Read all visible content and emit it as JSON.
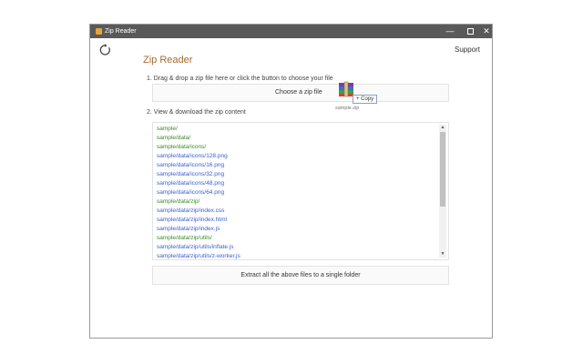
{
  "window": {
    "title": "Zip Reader",
    "minimize_glyph": "—",
    "close_glyph": "✕"
  },
  "header": {
    "support_label": "Support",
    "app_title": "Zip Reader"
  },
  "step1": {
    "text": "1. Drag & drop a zip file here or click the button to choose your file",
    "button_label": "Choose a zip file",
    "dragged_file_name": "sample.zip",
    "copy_tooltip": "+ Copy"
  },
  "step2": {
    "text": "2. View & download the zip content",
    "entries": [
      {
        "path": "sample/",
        "kind": "folder"
      },
      {
        "path": "sample/data/",
        "kind": "folder"
      },
      {
        "path": "sample/data/icons/",
        "kind": "folder"
      },
      {
        "path": "sample/data/icons/128.png",
        "kind": "file"
      },
      {
        "path": "sample/data/icons/16.png",
        "kind": "file"
      },
      {
        "path": "sample/data/icons/32.png",
        "kind": "file"
      },
      {
        "path": "sample/data/icons/48.png",
        "kind": "file"
      },
      {
        "path": "sample/data/icons/64.png",
        "kind": "file"
      },
      {
        "path": "sample/data/zip/",
        "kind": "folder"
      },
      {
        "path": "sample/data/zip/index.css",
        "kind": "file"
      },
      {
        "path": "sample/data/zip/index.html",
        "kind": "file"
      },
      {
        "path": "sample/data/zip/index.js",
        "kind": "file"
      },
      {
        "path": "sample/data/zip/utils/",
        "kind": "folder"
      },
      {
        "path": "sample/data/zip/utils/inflate.js",
        "kind": "file"
      },
      {
        "path": "sample/data/zip/utils/z-worker.js",
        "kind": "file"
      }
    ],
    "extract_label": "Extract all the above files to a single folder"
  },
  "colors": {
    "accent_title": "#a8692e",
    "folder_link": "#3a8a2c",
    "file_link": "#3a5fcf",
    "titlebar": "#595959"
  },
  "icons": [
    "app-icon",
    "refresh-icon",
    "zip-file-icon",
    "scroll-up-icon",
    "scroll-down-icon"
  ]
}
